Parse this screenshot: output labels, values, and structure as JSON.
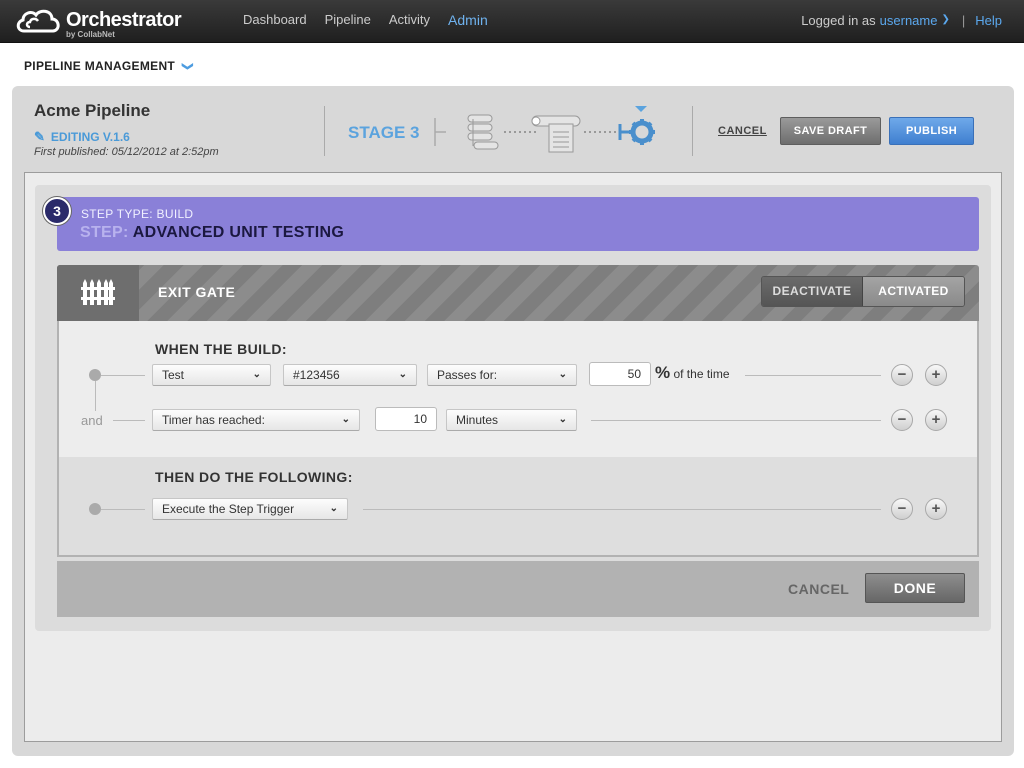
{
  "app": {
    "title": "Orchestrator",
    "subtitle": "by CollabNet"
  },
  "nav": {
    "items": [
      {
        "label": "Dashboard"
      },
      {
        "label": "Pipeline"
      },
      {
        "label": "Activity"
      },
      {
        "label": "Admin",
        "active": true
      }
    ]
  },
  "account": {
    "prefix": "Logged in as",
    "username": "username",
    "help": "Help"
  },
  "section": {
    "title": "PIPELINE MANAGEMENT"
  },
  "pipeline": {
    "name": "Acme Pipeline",
    "editing": "EDITING V.1.6",
    "published": "First published: 05/12/2012 at 2:52pm",
    "stage": "STAGE 3",
    "actions": {
      "cancel": "CANCEL",
      "save": "SAVE DRAFT",
      "publish": "PUBLISH"
    }
  },
  "step": {
    "number": "3",
    "type": "STEP TYPE: BUILD",
    "prefix": "STEP:",
    "name": "ADVANCED UNIT TESTING"
  },
  "gate": {
    "title": "EXIT GATE",
    "deactivate": "DEACTIVATE",
    "activated": "ACTIVATED"
  },
  "conditions": {
    "when_title": "WHEN THE BUILD:",
    "and_label": "and",
    "row1": {
      "field": "Test",
      "build": "#123456",
      "comparator": "Passes for:",
      "value": "50",
      "pct_symbol": "%",
      "unit": "of the time"
    },
    "row2": {
      "field": "Timer has reached:",
      "value": "10",
      "unit": "Minutes"
    },
    "then_title": "THEN DO THE FOLLOWING:",
    "action": "Execute the Step Trigger",
    "remove": "−",
    "add": "+"
  },
  "footer": {
    "cancel": "CANCEL",
    "done": "DONE"
  },
  "colors": {
    "accent": "#5ba3de",
    "step_banner": "#8a80d8",
    "publish": "#4a86d6"
  }
}
